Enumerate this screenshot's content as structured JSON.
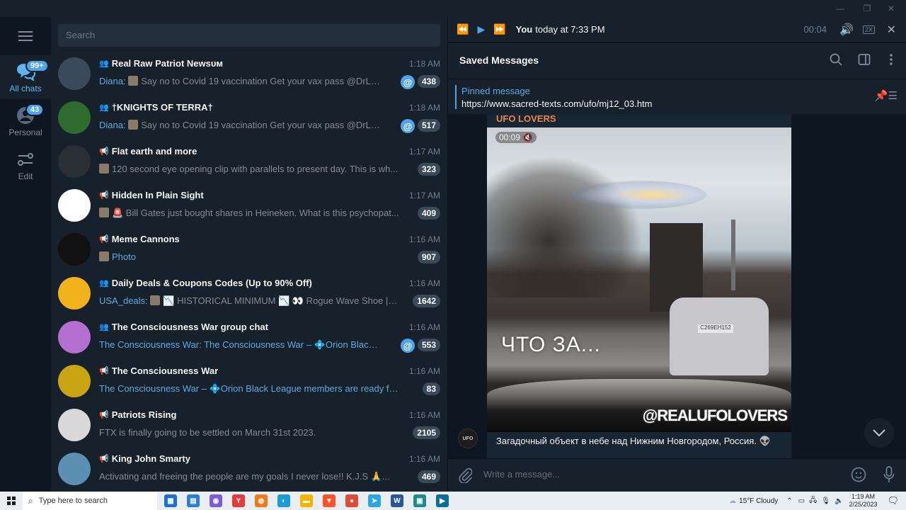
{
  "window": {
    "controls": {
      "minimize": "—",
      "restore": "❐",
      "close": "✕"
    }
  },
  "folders": {
    "menu_icon": "hamburger-icon",
    "items": [
      {
        "label": "All chats",
        "badge": "99+",
        "icon": "chats-icon",
        "active": true
      },
      {
        "label": "Personal",
        "badge": "43",
        "icon": "person-icon",
        "active": false
      },
      {
        "label": "Edit",
        "badge": "",
        "icon": "sliders-icon",
        "active": false
      }
    ]
  },
  "search": {
    "placeholder": "Search"
  },
  "chats": [
    {
      "type": "group",
      "title": "Real Raw Patriot Newsᴜᴍ",
      "time": "1:18 AM",
      "sender": "Diana:",
      "preview": "Say no to Covid 19 vaccination Get your vax pass @DrLuke...",
      "unread": "438",
      "mention": true,
      "thumb": true,
      "avatar_color": "#3b4a5a"
    },
    {
      "type": "group",
      "title": "†KNIGHTS OF TERRA†",
      "time": "1:18 AM",
      "sender": "Diana:",
      "preview": "Say no to Covid 19 vaccination Get your vax pass @DrLuke...",
      "unread": "517",
      "mention": true,
      "thumb": true,
      "avatar_color": "#2f6b2e"
    },
    {
      "type": "channel",
      "title": "Flat earth and more",
      "time": "1:17 AM",
      "sender": "",
      "preview": "120 second eye opening clip with parallels to present day.  This is wh...",
      "unread": "323",
      "mention": false,
      "thumb": true,
      "avatar_color": "#2a2f36"
    },
    {
      "type": "channel",
      "title": "Hidden In Plain Sight",
      "time": "1:17 AM",
      "sender": "",
      "preview": "🚨 Bill Gates just bought shares in Heineken.  What is this psychopat...",
      "unread": "409",
      "mention": false,
      "thumb": true,
      "avatar_color": "#ffffff"
    },
    {
      "type": "channel",
      "title": "Meme Cannons",
      "time": "1:16 AM",
      "sender": "",
      "preview": "Photo",
      "preview_link": true,
      "unread": "907",
      "mention": false,
      "thumb": true,
      "avatar_color": "#111111"
    },
    {
      "type": "group",
      "title": "Daily Deals & Coupons Codes (Up to 90% Off)",
      "time": "1:16 AM",
      "sender": "USA_deals:",
      "preview": "📉 HISTORICAL MINIMUM 📉 👀 Rogue Wave Shoe | Hig...",
      "unread": "1642",
      "mention": false,
      "thumb": true,
      "avatar_color": "#f2b21b"
    },
    {
      "type": "group",
      "title": "The Consciousness War group chat",
      "time": "1:16 AM",
      "sender": "",
      "preview": "The Consciousness War: The Consciousness War – 💠Orion Black Le...",
      "preview_link": true,
      "unread": "553",
      "mention": true,
      "thumb": false,
      "avatar_color": "#b56fd0"
    },
    {
      "type": "channel",
      "title": "The Consciousness War",
      "time": "1:16 AM",
      "sender": "",
      "preview": "The Consciousness War – 💠Orion Black League members are ready for S...",
      "preview_link": true,
      "unread": "83",
      "mention": false,
      "thumb": false,
      "avatar_color": "#c9a514"
    },
    {
      "type": "channel",
      "title": "Patriots Rising",
      "time": "1:16 AM",
      "sender": "",
      "preview": "FTX is finally going to be settled on March 31st 2023.",
      "unread": "2105",
      "mention": false,
      "thumb": false,
      "avatar_color": "#d8d8d8"
    },
    {
      "type": "channel",
      "title": "King John Smarty",
      "time": "1:16 AM",
      "sender": "",
      "preview": "Activating and freeing the people are my goals   I never lose!!   K.J.S 🙏...",
      "unread": "469",
      "mention": false,
      "thumb": false,
      "avatar_color": "#5b8fb3"
    }
  ],
  "player": {
    "who": "You",
    "when": "today at 7:33 PM",
    "position": "00:04",
    "speed": "2X"
  },
  "chat_header": {
    "title": "Saved Messages"
  },
  "pinned": {
    "label": "Pinned message",
    "text": "https://www.sacred-texts.com/ufo/mj12_03.htm"
  },
  "message": {
    "source": "UFO LOVERS",
    "video_duration": "00:09",
    "video_caption": "ЧТО ЗА...",
    "video_watermark": "@REALUFOLOVERS",
    "plate": "С269ЕН152",
    "text": "Загадочный объект в небе над Нижним Новгородом, Россия. 👽",
    "avatar_text": "UFO"
  },
  "composer": {
    "placeholder": "Write a message..."
  },
  "taskbar": {
    "search_placeholder": "Type here to search",
    "apps": [
      "Microsoft Store",
      "File Explorer",
      "Copilot",
      "Yandex",
      "Firefox",
      "Edge",
      "Files",
      "Brave",
      "Chrome",
      "Telegram",
      "Word",
      "Screen Recorder",
      "Video Editor"
    ],
    "weather": "15°F  Cloudy",
    "time": "1:19 AM",
    "date": "2/25/2023"
  },
  "colors": {
    "accent": "#4fa3e7",
    "sidebar_bg": "#17212b",
    "chat_bg": "#0e1621",
    "source_name": "#e8864a"
  }
}
